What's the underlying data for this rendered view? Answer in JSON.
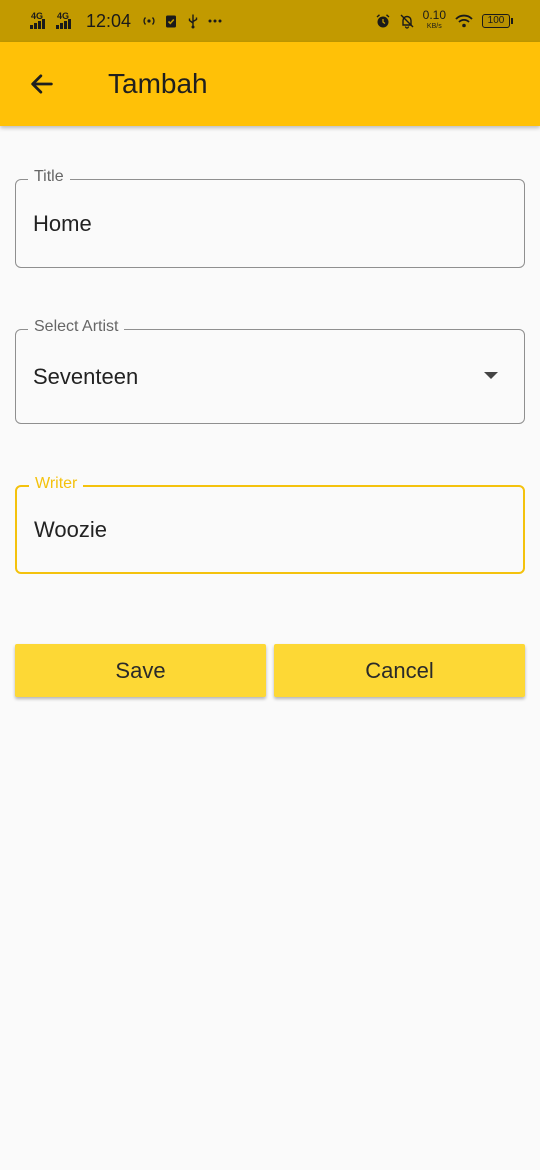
{
  "status_bar": {
    "network_1": "4G",
    "network_2": "4G",
    "time": "12:04",
    "speed_value": "0.10",
    "speed_unit": "KB/s",
    "battery": "100"
  },
  "app_bar": {
    "title": "Tambah",
    "back_icon": "arrow-left-icon",
    "color": "#ffc107"
  },
  "form": {
    "title_field": {
      "label": "Title",
      "value": "Home"
    },
    "artist_field": {
      "label": "Select Artist",
      "value": "Seventeen"
    },
    "writer_field": {
      "label": "Writer",
      "value": "Woozie",
      "focus_color": "#f4c20d"
    }
  },
  "actions": {
    "save_label": "Save",
    "cancel_label": "Cancel",
    "button_color": "#fdd835"
  }
}
